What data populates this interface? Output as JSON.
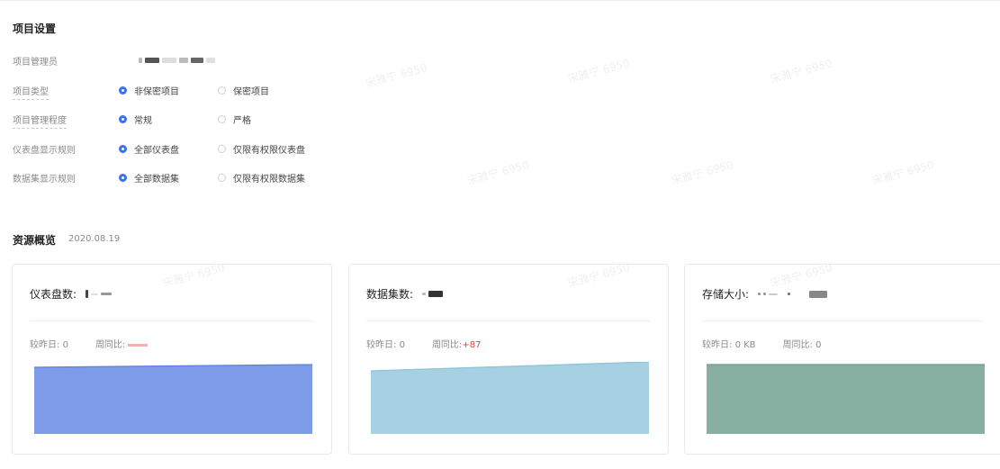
{
  "project_settings": {
    "title": "项目设置",
    "admin_label": "项目管理员",
    "rows": [
      {
        "label": "项目类型",
        "options": [
          "非保密项目",
          "保密项目"
        ],
        "selected": 0
      },
      {
        "label": "项目管理程度",
        "options": [
          "常规",
          "严格"
        ],
        "selected": 0
      },
      {
        "label": "仪表盘显示规则",
        "options": [
          "全部仪表盘",
          "仅限有权限仪表盘"
        ],
        "selected": 0
      },
      {
        "label": "数据集显示规则",
        "options": [
          "全部数据集",
          "仅限有权限数据集"
        ],
        "selected": 0
      }
    ]
  },
  "resource_overview": {
    "title": "资源概览",
    "date": "2020.08.19",
    "cards": [
      {
        "label": "仪表盘数:",
        "day_compare_label": "较昨日:",
        "day_compare_value": "0",
        "week_compare_label": "周同比:",
        "fill_color": "#7e9be9",
        "line_color": "#5c7fe0"
      },
      {
        "label": "数据集数:",
        "day_compare_label": "较昨日:",
        "day_compare_value": "0",
        "week_compare_label": "周同比:",
        "week_compare_value": "+87",
        "fill_color": "#a5d1e3",
        "line_color": "#8cc3db"
      },
      {
        "label": "存储大小:",
        "day_compare_label": "较昨日:",
        "day_compare_value": "0 KB",
        "week_compare_label": "周同比:",
        "week_compare_value": "0",
        "fill_color": "#87afa2",
        "line_color": "#6f998c"
      }
    ]
  },
  "watermark": {
    "text": "宋雅宁 6950"
  }
}
